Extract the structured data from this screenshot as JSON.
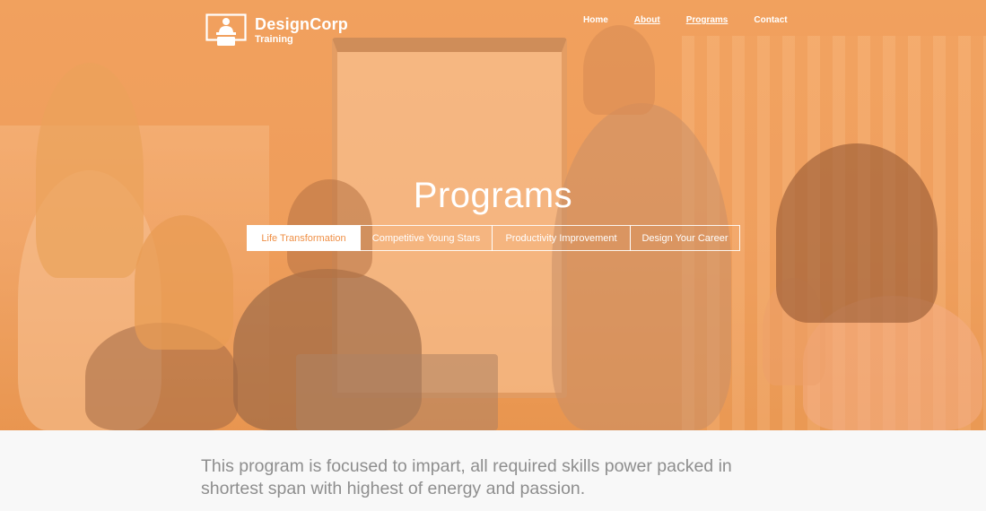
{
  "brand": {
    "name": "DesignCorp",
    "tagline": "Training",
    "logo_icon": "presenter-at-podium-icon"
  },
  "nav": {
    "items": [
      {
        "label": "Home",
        "underlined": false
      },
      {
        "label": "About",
        "underlined": true
      },
      {
        "label": "Programs",
        "underlined": true
      },
      {
        "label": "Contact",
        "underlined": false
      }
    ]
  },
  "hero": {
    "title": "Programs",
    "overlay_color": "#f09650"
  },
  "tabs": [
    {
      "label": "Life Transformation",
      "active": true
    },
    {
      "label": "Competitive Young Stars",
      "active": false
    },
    {
      "label": "Productivity Improvement",
      "active": false
    },
    {
      "label": "Design Your Career",
      "active": false
    }
  ],
  "content": {
    "intro": "This program is focused to impart, all required skills power packed in shortest span with highest of energy and passion."
  },
  "colors": {
    "accent": "#ef8f45",
    "body_text": "#8e8e8e",
    "page_bg": "#f8f8f8"
  }
}
